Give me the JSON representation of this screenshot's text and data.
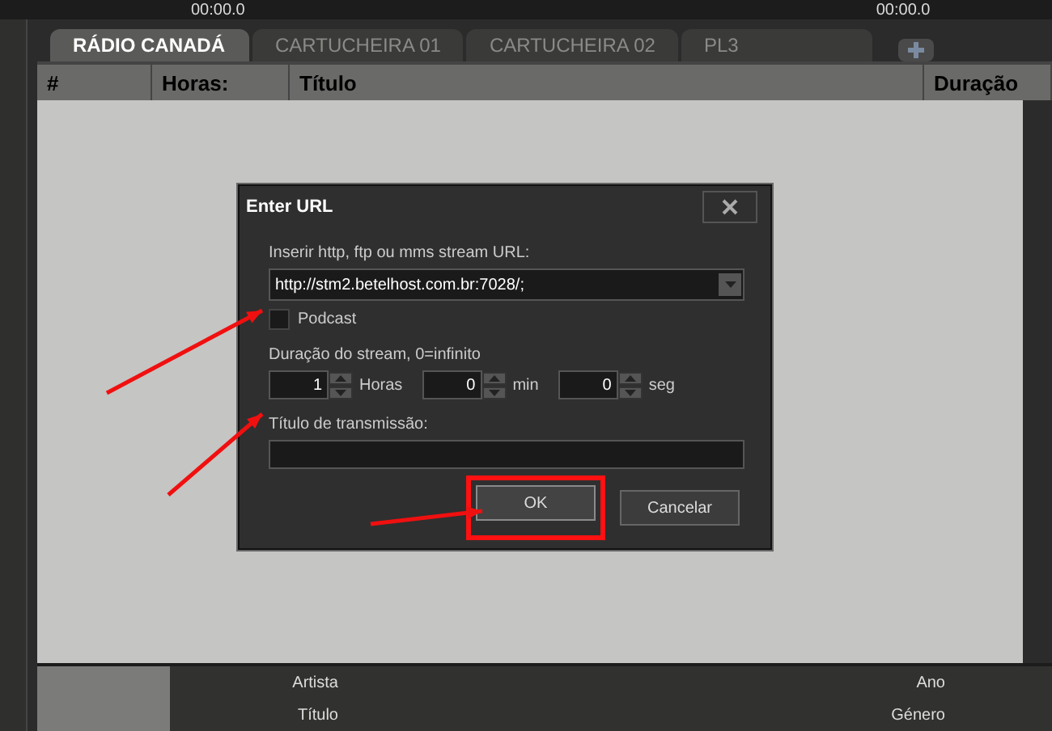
{
  "timers": [
    "00:00.0",
    "00:00.0"
  ],
  "tabs": [
    {
      "label": "RÁDIO CANADÁ",
      "selected": true
    },
    {
      "label": "CARTUCHEIRA 01",
      "selected": false
    },
    {
      "label": "CARTUCHEIRA 02",
      "selected": false
    },
    {
      "label": "PL3",
      "selected": false
    }
  ],
  "columns": [
    "#",
    "Horas:",
    "Título",
    "Duração"
  ],
  "dialog": {
    "title": "Enter URL",
    "url_label": "Inserir http, ftp ou mms stream URL:",
    "url_value": "http://stm2.betelhost.com.br:7028/;",
    "podcast": {
      "label": "Podcast",
      "checked": false
    },
    "duration_label": "Duração do stream, 0=infinito",
    "spinners": [
      {
        "value": "1",
        "unit": "Horas"
      },
      {
        "value": "0",
        "unit": "min"
      },
      {
        "value": "0",
        "unit": "seg"
      }
    ],
    "title_label": "Título de transmissão:",
    "buttons": [
      {
        "label": "OK",
        "highlighted": true
      },
      {
        "label": "Cancelar",
        "highlighted": false
      }
    ]
  },
  "info": {
    "left": [
      "Artista",
      "Título"
    ],
    "right": [
      "Ano",
      "Género"
    ]
  }
}
